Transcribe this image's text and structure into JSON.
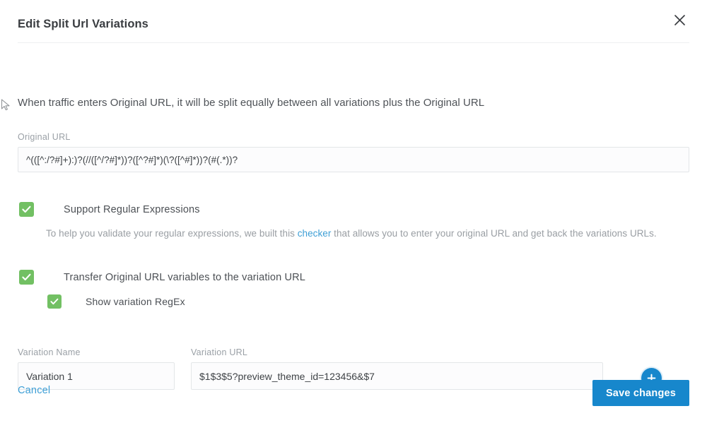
{
  "modal": {
    "title": "Edit Split Url Variations",
    "close_icon": "close-icon",
    "intro": "When traffic enters Original URL, it will be split equally between all variations plus the Original URL"
  },
  "original_url": {
    "label": "Original URL",
    "value": "^(([^:/?#]+):)?(//([^/?#]*))?([^?#]*)(\\?([^#]*))?(#(.*))?",
    "placeholder": "Original URL"
  },
  "options": {
    "support_regex": {
      "label": "Support Regular Expressions",
      "checked": true,
      "checkbox_icon": "checkmark-icon",
      "helper_prefix": "To help you validate your regular expressions, we built this ",
      "helper_link": "checker",
      "helper_suffix": " that allows you to enter your original URL and get back the variations URLs."
    },
    "transfer_variables": {
      "label": "Transfer Original URL variables to the variation URL",
      "checked": true,
      "checkbox_icon": "checkmark-icon"
    },
    "show_variation_regex": {
      "label": "Show variation RegEx",
      "checked": true,
      "checkbox_icon": "checkmark-icon"
    }
  },
  "variation": {
    "name_label": "Variation Name",
    "name_value": "Variation 1",
    "name_placeholder": "Variation Name",
    "url_label": "Variation URL",
    "url_value": "$1$3$5?preview_theme_id=123456&$7",
    "url_placeholder": "Variation URL",
    "add_icon": "plus-icon"
  },
  "footer": {
    "cancel_label": "Cancel",
    "save_label": "Save changes"
  },
  "colors": {
    "accent_blue": "#1787cc",
    "link_blue": "#3e9fd6",
    "checkbox_green": "#72c063",
    "text_primary": "#44474b",
    "text_muted": "#9aa0a6",
    "border": "#e3e6e8"
  }
}
